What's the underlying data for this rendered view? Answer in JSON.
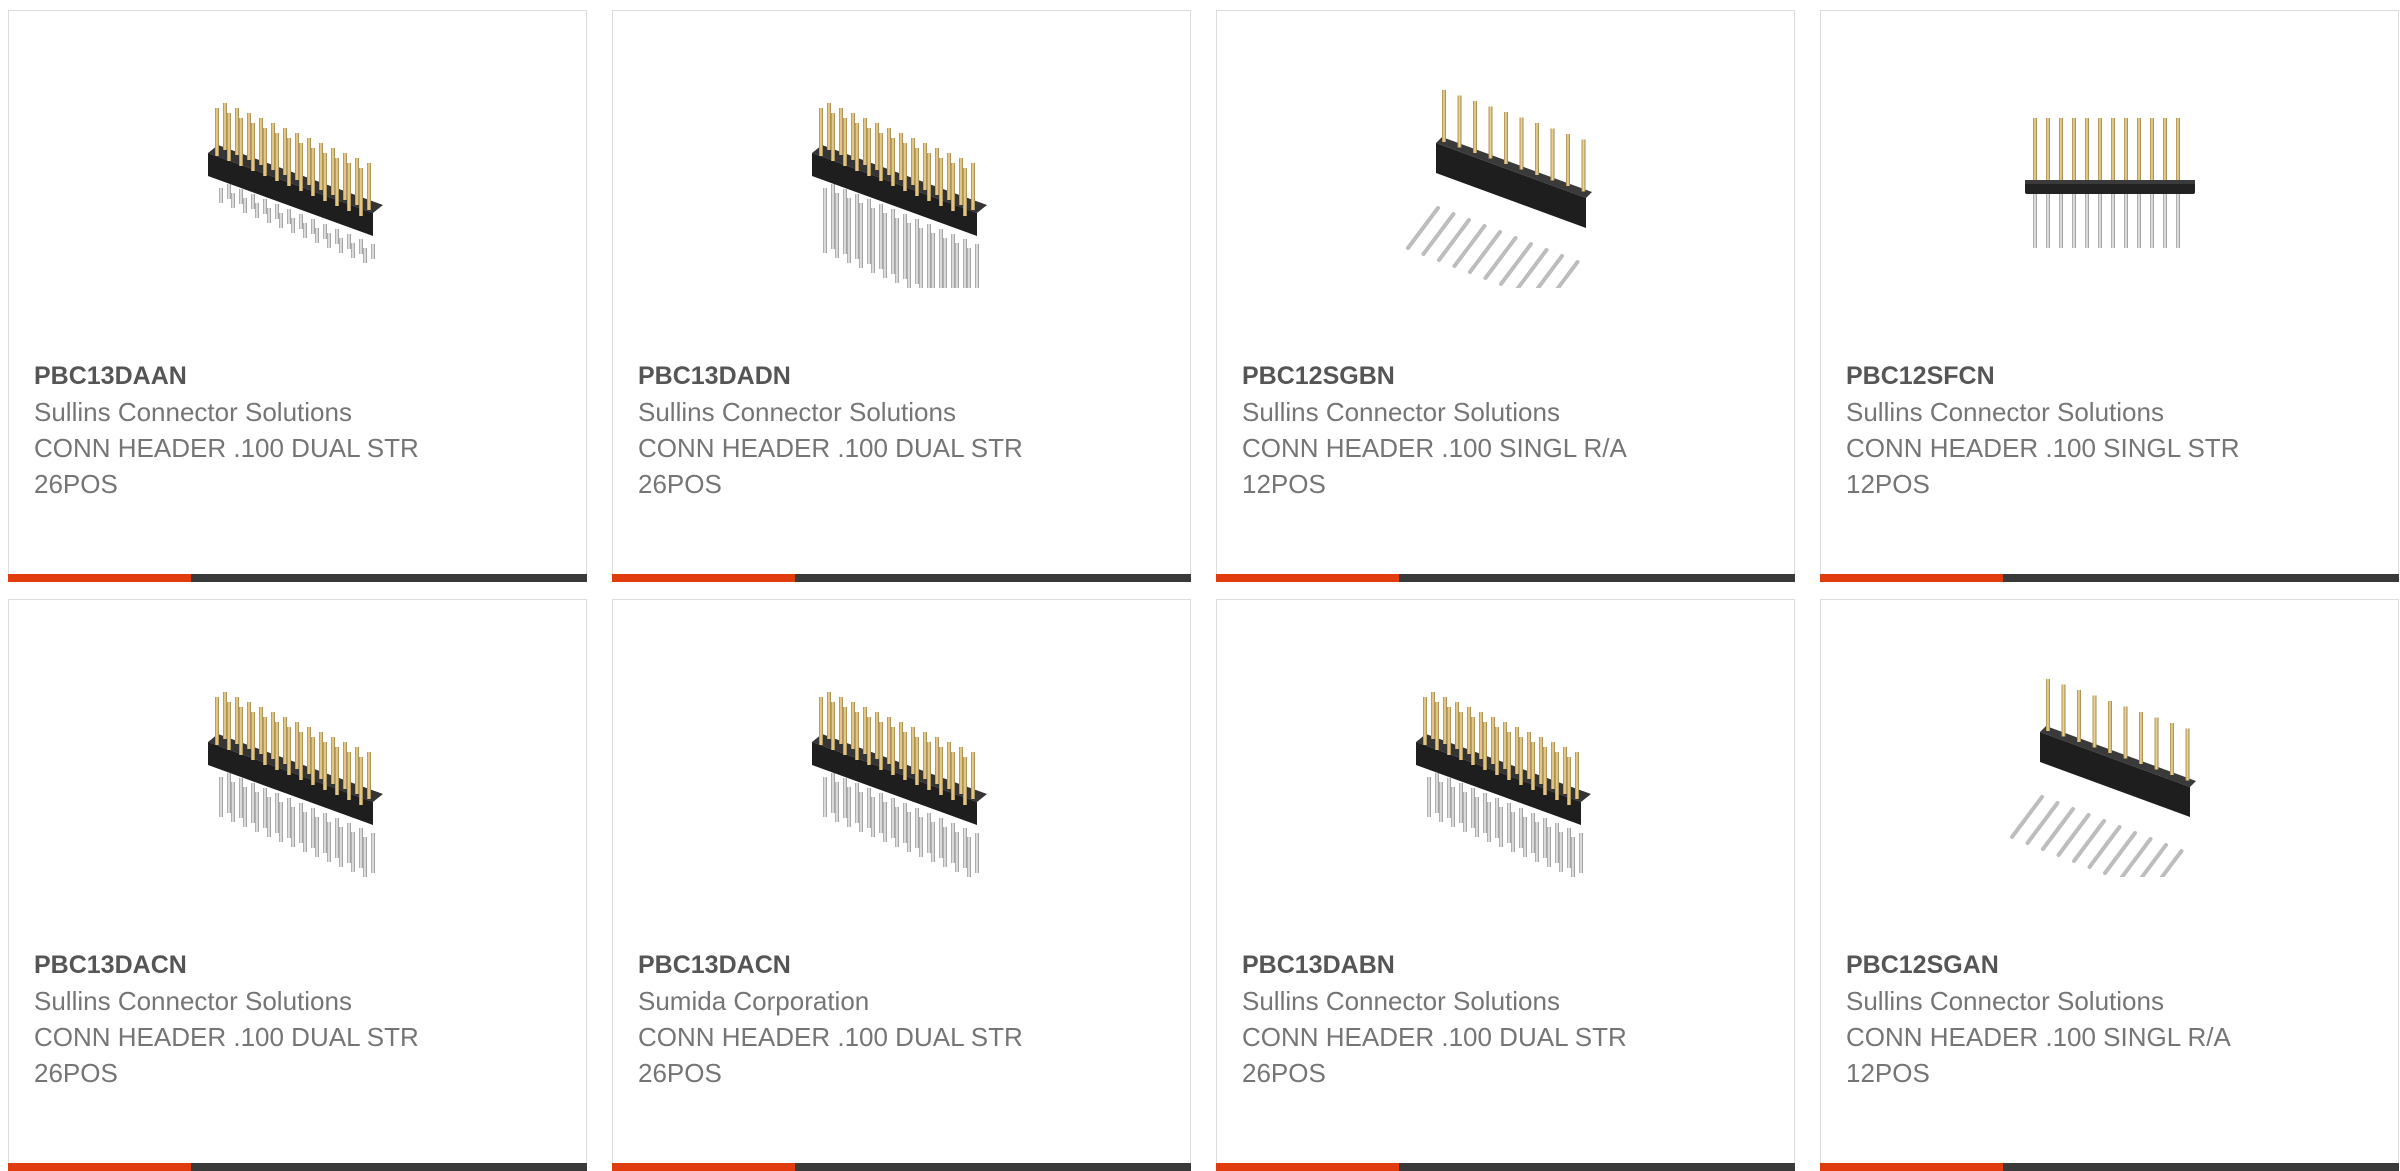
{
  "colors": {
    "accent_bar": "#e03c0e",
    "dark_bar": "#3a3a3a",
    "part_number_text": "#555555",
    "body_text": "#757575"
  },
  "products": [
    {
      "part_number": "PBC13DAAN",
      "manufacturer": "Sullins Connector Solutions",
      "description": "CONN HEADER .100 DUAL STR 26POS",
      "image": "dual-row-straight-header-short-pins-icon"
    },
    {
      "part_number": "PBC13DADN",
      "manufacturer": "Sullins Connector Solutions",
      "description": "CONN HEADER .100 DUAL STR 26POS",
      "image": "dual-row-straight-header-long-pins-icon"
    },
    {
      "part_number": "PBC12SGBN",
      "manufacturer": "Sullins Connector Solutions",
      "description": "CONN HEADER .100 SINGL R/A 12POS",
      "image": "single-row-right-angle-header-icon"
    },
    {
      "part_number": "PBC12SFCN",
      "manufacturer": "Sullins Connector Solutions",
      "description": "CONN HEADER .100 SINGL STR 12POS",
      "image": "single-row-straight-header-icon"
    },
    {
      "part_number": "PBC13DACN",
      "manufacturer": "Sullins Connector Solutions",
      "description": "CONN HEADER .100 DUAL STR 26POS",
      "image": "dual-row-straight-header-icon"
    },
    {
      "part_number": "PBC13DACN",
      "manufacturer": "Sumida Corporation",
      "description": "CONN HEADER .100 DUAL STR 26POS",
      "image": "dual-row-straight-header-icon"
    },
    {
      "part_number": "PBC13DABN",
      "manufacturer": "Sullins Connector Solutions",
      "description": "CONN HEADER .100 DUAL STR 26POS",
      "image": "dual-row-straight-header-icon"
    },
    {
      "part_number": "PBC12SGAN",
      "manufacturer": "Sullins Connector Solutions",
      "description": "CONN HEADER .100 SINGL R/A 12POS",
      "image": "single-row-right-angle-header-icon"
    }
  ]
}
